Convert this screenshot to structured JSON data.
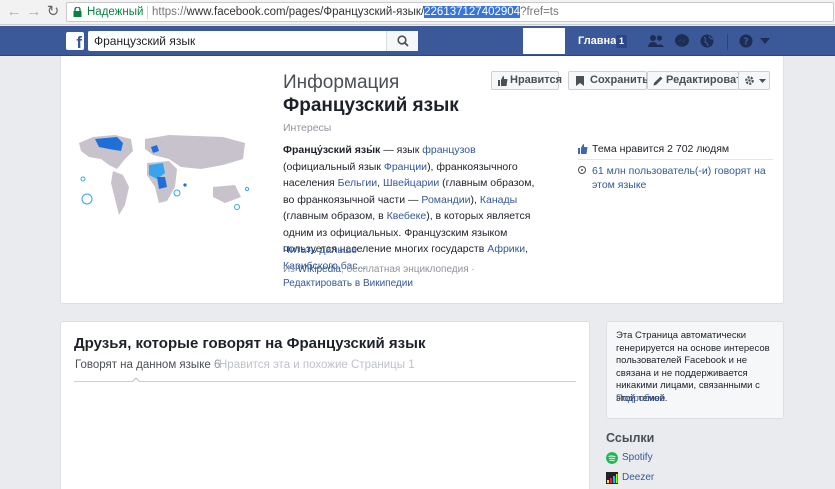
{
  "browser": {
    "secure_label": "Надежный",
    "url_prefix": "https://",
    "url_main": "www.facebook.com/pages/Французский-язык/",
    "url_selected": "226137127402904",
    "url_suffix": "?fref=ts"
  },
  "header": {
    "search_value": "Французский язык",
    "home_label": "Главная",
    "home_count": "1",
    "brand_color": "#3b5998"
  },
  "page": {
    "title_prefix": "Информация",
    "title_name": "Французский язык",
    "category": "Интересы",
    "buttons": {
      "like": "Нравится",
      "save": "Сохранить",
      "edit": "Редактировать"
    },
    "about": {
      "term": "Францу́зский язы́к",
      "t1": " — язык ",
      "l1": "французов",
      "t2": " (официальный язык ",
      "l2": "Франции",
      "t3": "), франкоязычного населения ",
      "l3": "Бельгии",
      "t4": ", ",
      "l4": "Швейцарии",
      "t5": " (главным образом, во франкоязычной части — ",
      "l5": "Романдии",
      "t6": "), ",
      "l6": "Канады",
      "t7": " (главным образом, в ",
      "l7": "Квебеке",
      "t8": "), в которых является одним из официальных. Французским языком пользуется население многих государств ",
      "l8": "Африки",
      "t9": ", ",
      "l9": "Карибского бас...",
      "read_more": "Читать дальше"
    },
    "source": {
      "from": "Из ",
      "wikipedia": "Wikipedia",
      "rest": ", бесплатная энциклопедия · ",
      "edit": "Редактировать в Википедии"
    },
    "stats": {
      "likes": "Тема нравится 2 702 людям",
      "speakers": "61 млн пользователь(-и) говорят на этом языке"
    }
  },
  "friends": {
    "title": "Друзья, которые говорят на Французский язык",
    "tab_active": "Говорят на данном языке",
    "tab_active_count": "6",
    "tab_inactive": "Нравится эта и похожие Страницы",
    "tab_inactive_count": "1"
  },
  "notice": {
    "text": "Эта Страница автоматически генерируется на основе интересов пользователей Facebook и не связана и не поддерживается никакими лицами, связанными с этой темой.",
    "more": "Подробнее"
  },
  "links": {
    "title": "Ссылки",
    "items": [
      {
        "label": "Spotify",
        "icon": "spotify-icon",
        "color": "#1db954"
      },
      {
        "label": "Deezer",
        "icon": "deezer-icon",
        "color": "#222222"
      }
    ]
  }
}
